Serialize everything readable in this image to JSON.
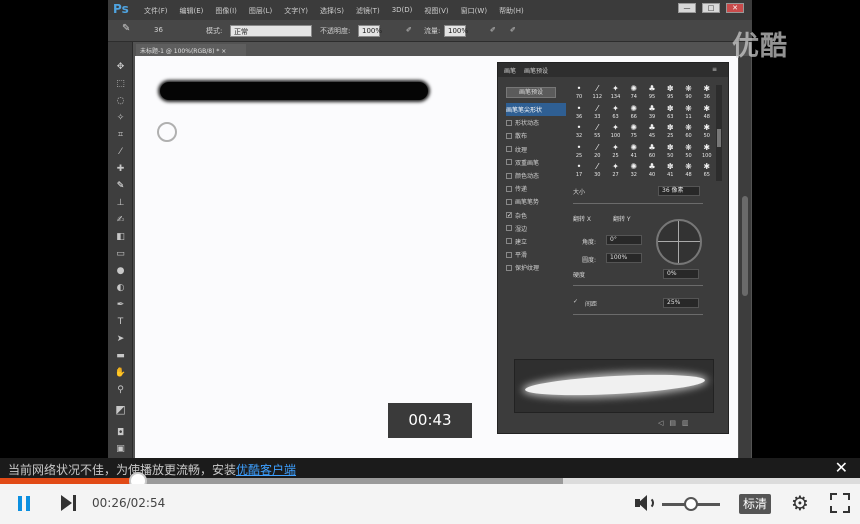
{
  "photoshop": {
    "logo": "Ps",
    "menu": [
      "文件(F)",
      "编辑(E)",
      "图像(I)",
      "图层(L)",
      "文字(Y)",
      "选择(S)",
      "滤镜(T)",
      "3D(D)",
      "视图(V)",
      "窗口(W)",
      "帮助(H)"
    ],
    "window_buttons": {
      "minimize": "—",
      "restore": "□",
      "close": "✕"
    },
    "options": {
      "size": "36",
      "mode_label": "模式:",
      "mode_value": "正常",
      "opacity_label": "不透明度:",
      "opacity_value": "100%",
      "flow_label": "流量:",
      "flow_value": "100%"
    },
    "doc_tab": "未标题-1 @ 100%(RGB/8) *  ×",
    "brush_panel": {
      "tabs": [
        "画笔",
        "画笔预设"
      ],
      "preset_button": "画笔预设",
      "properties": [
        {
          "label": "画笔笔尖形状",
          "checked": false,
          "selected": true
        },
        {
          "label": "形状动态",
          "checked": false,
          "selected": false
        },
        {
          "label": "散布",
          "checked": false,
          "selected": false
        },
        {
          "label": "纹理",
          "checked": false,
          "selected": false
        },
        {
          "label": "双重画笔",
          "checked": false,
          "selected": false
        },
        {
          "label": "颜色动态",
          "checked": false,
          "selected": false
        },
        {
          "label": "传递",
          "checked": false,
          "selected": false
        },
        {
          "label": "画笔笔势",
          "checked": false,
          "selected": false
        },
        {
          "label": "杂色",
          "checked": true,
          "selected": false
        },
        {
          "label": "湿边",
          "checked": false,
          "selected": false
        },
        {
          "label": "建立",
          "checked": false,
          "selected": false
        },
        {
          "label": "平滑",
          "checked": false,
          "selected": false
        },
        {
          "label": "保护纹理",
          "checked": false,
          "selected": false
        }
      ],
      "tip_sizes": [
        "70",
        "112",
        "134",
        "74",
        "95",
        "95",
        "90",
        "36",
        "36",
        "33",
        "63",
        "66",
        "39",
        "63",
        "11",
        "48",
        "32",
        "55",
        "100",
        "75",
        "45",
        "25",
        "60",
        "50",
        "25",
        "20",
        "25",
        "41",
        "60",
        "50",
        "50",
        "100",
        "17",
        "30",
        "27",
        "32",
        "40",
        "41",
        "48",
        "65"
      ],
      "size_label": "大小",
      "size_value": "36 像素",
      "flip_x": "翻转 X",
      "flip_y": "翻转 Y",
      "angle_label": "角度:",
      "angle_value": "0°",
      "roundness_label": "圆度:",
      "roundness_value": "100%",
      "hardness_label": "硬度",
      "hardness_value": "0%",
      "spacing_label": "间距",
      "spacing_value": "25%"
    }
  },
  "overlay_time": "00:43",
  "watermark": "优酷",
  "notice": {
    "text": "当前网络状况不佳，为使播放更流畅，安装",
    "link": "优酷客户端",
    "close": "✕"
  },
  "player": {
    "current_time": "00:26",
    "duration": "02:54",
    "time_display": "00:26/02:54",
    "played_fraction": 0.16,
    "buffered_fraction": 0.655,
    "volume_fraction": 0.5,
    "quality_label": "标清",
    "settings_icon": "gear-icon",
    "fullscreen_icon": "fullscreen-icon"
  }
}
